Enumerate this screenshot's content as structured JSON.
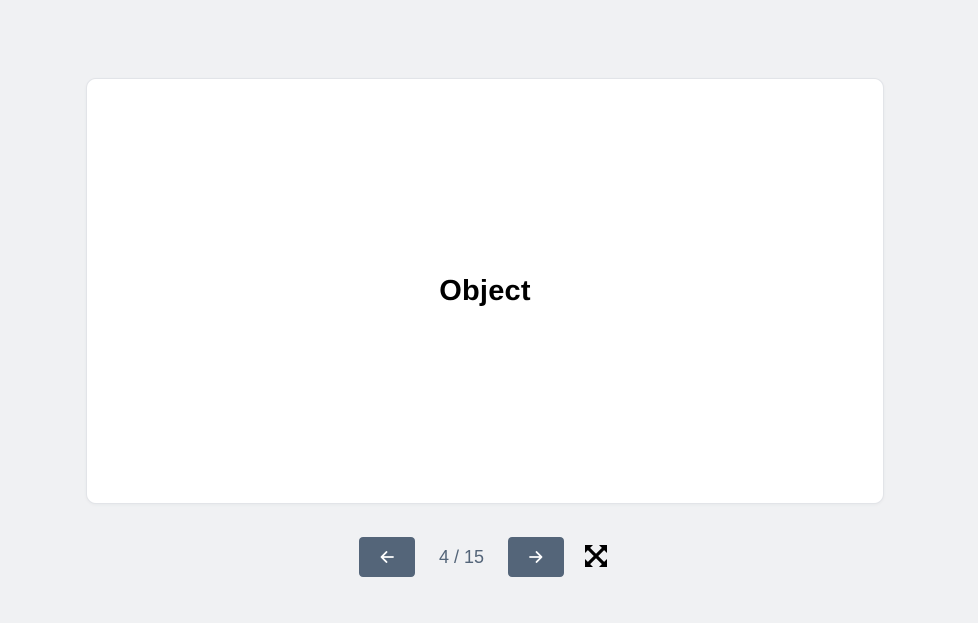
{
  "card": {
    "term": "Object"
  },
  "controls": {
    "prev_icon": "arrow-left-icon",
    "next_icon": "arrow-right-icon",
    "counter": "4 / 15",
    "current": 4,
    "total": 15,
    "fullscreen_icon": "expand-icon"
  },
  "colors": {
    "background": "#f0f1f3",
    "card": "#ffffff",
    "button": "#546579",
    "counter_text": "#546579",
    "term_text": "#000000"
  }
}
